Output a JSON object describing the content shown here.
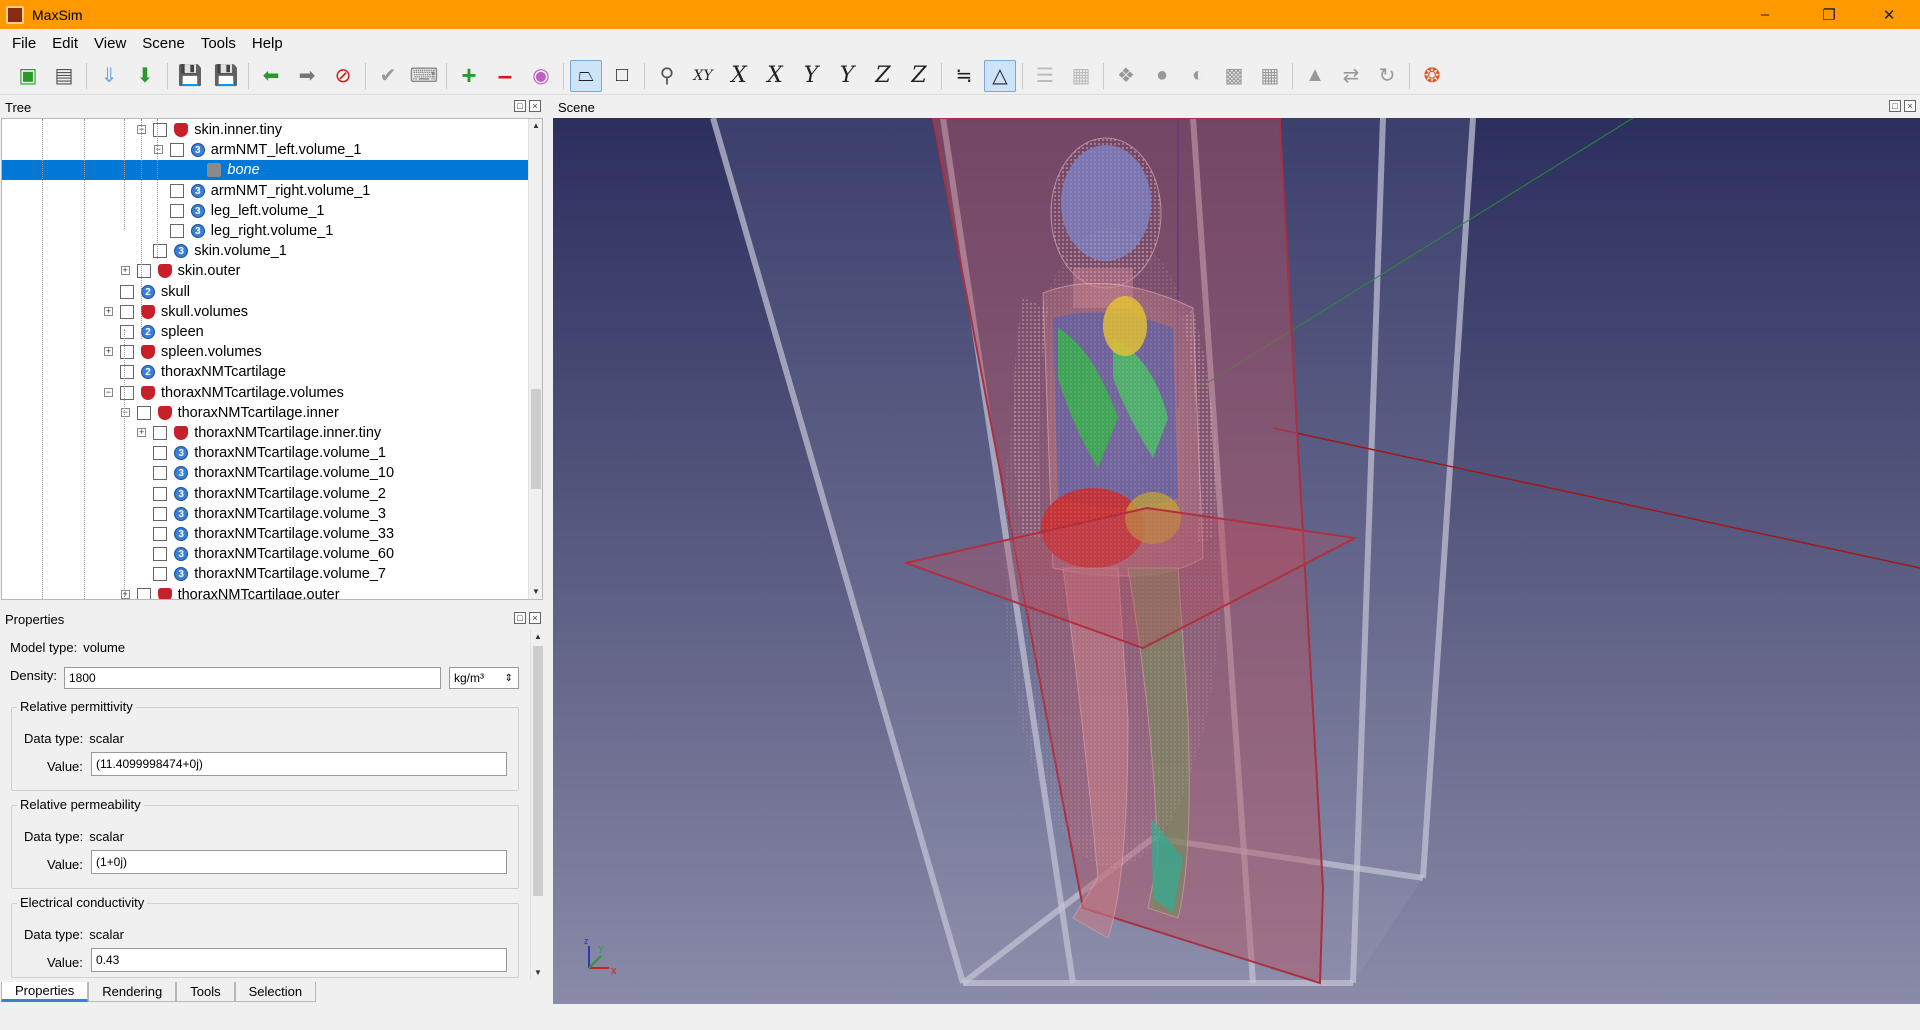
{
  "window": {
    "title": "MaxSim"
  },
  "menu": [
    "File",
    "Edit",
    "View",
    "Scene",
    "Tools",
    "Help"
  ],
  "panels": {
    "tree_title": "Tree",
    "properties_title": "Properties",
    "scene_title": "Scene"
  },
  "tree": {
    "selected_index": 2,
    "rows": [
      {
        "label": "skin.inner.tiny",
        "icon": "shield-icon"
      },
      {
        "label": "armNMT_left.volume_1",
        "icon": "volume-icon",
        "badge": "3"
      },
      {
        "label": "bone",
        "icon": "material-icon"
      },
      {
        "label": "armNMT_right.volume_1",
        "icon": "volume-icon",
        "badge": "3"
      },
      {
        "label": "leg_left.volume_1",
        "icon": "volume-icon",
        "badge": "3"
      },
      {
        "label": "leg_right.volume_1",
        "icon": "volume-icon",
        "badge": "3"
      },
      {
        "label": "skin.volume_1",
        "icon": "volume-icon",
        "badge": "3"
      },
      {
        "label": "skin.outer",
        "icon": "shield-icon"
      },
      {
        "label": "skull",
        "icon": "surface-icon",
        "badge": "2"
      },
      {
        "label": "skull.volumes",
        "icon": "shield-icon"
      },
      {
        "label": "spleen",
        "icon": "surface-icon",
        "badge": "2"
      },
      {
        "label": "spleen.volumes",
        "icon": "shield-icon"
      },
      {
        "label": "thoraxNMTcartilage",
        "icon": "surface-icon",
        "badge": "2"
      },
      {
        "label": "thoraxNMTcartilage.volumes",
        "icon": "shield-icon"
      },
      {
        "label": "thoraxNMTcartilage.inner",
        "icon": "shield-icon"
      },
      {
        "label": "thoraxNMTcartilage.inner.tiny",
        "icon": "shield-icon"
      },
      {
        "label": "thoraxNMTcartilage.volume_1",
        "icon": "volume-icon",
        "badge": "3"
      },
      {
        "label": "thoraxNMTcartilage.volume_10",
        "icon": "volume-icon",
        "badge": "3"
      },
      {
        "label": "thoraxNMTcartilage.volume_2",
        "icon": "volume-icon",
        "badge": "3"
      },
      {
        "label": "thoraxNMTcartilage.volume_3",
        "icon": "volume-icon",
        "badge": "3"
      },
      {
        "label": "thoraxNMTcartilage.volume_33",
        "icon": "volume-icon",
        "badge": "3"
      },
      {
        "label": "thoraxNMTcartilage.volume_60",
        "icon": "volume-icon",
        "badge": "3"
      },
      {
        "label": "thoraxNMTcartilage.volume_7",
        "icon": "volume-icon",
        "badge": "3"
      },
      {
        "label": "thoraxNMTcartilage.outer",
        "icon": "shield-icon"
      }
    ]
  },
  "properties": {
    "model_type_label": "Model type:",
    "model_type_value": "volume",
    "density_label": "Density:",
    "density_value": "1800",
    "density_unit": "kg/m³",
    "groups": [
      {
        "title": "Relative permittivity",
        "data_type_label": "Data type:",
        "data_type": "scalar",
        "value_label": "Value:",
        "value": "(11.4099998474+0j)"
      },
      {
        "title": "Relative permeability",
        "data_type_label": "Data type:",
        "data_type": "scalar",
        "value_label": "Value:",
        "value": "(1+0j)"
      },
      {
        "title": "Electrical conductivity",
        "data_type_label": "Data type:",
        "data_type": "scalar",
        "value_label": "Value:",
        "value": "0.43"
      }
    ]
  },
  "tabs": [
    "Properties",
    "Rendering",
    "Tools",
    "Selection"
  ],
  "active_tab": "Properties",
  "scene": {
    "axis_labels": {
      "x": "x",
      "y": "y",
      "z": "z"
    }
  },
  "colors": {
    "titlebar": "#ff9900",
    "selection": "#0078d7",
    "scene_top": "#2c2f5e",
    "scene_bottom": "#8a8ba8"
  }
}
